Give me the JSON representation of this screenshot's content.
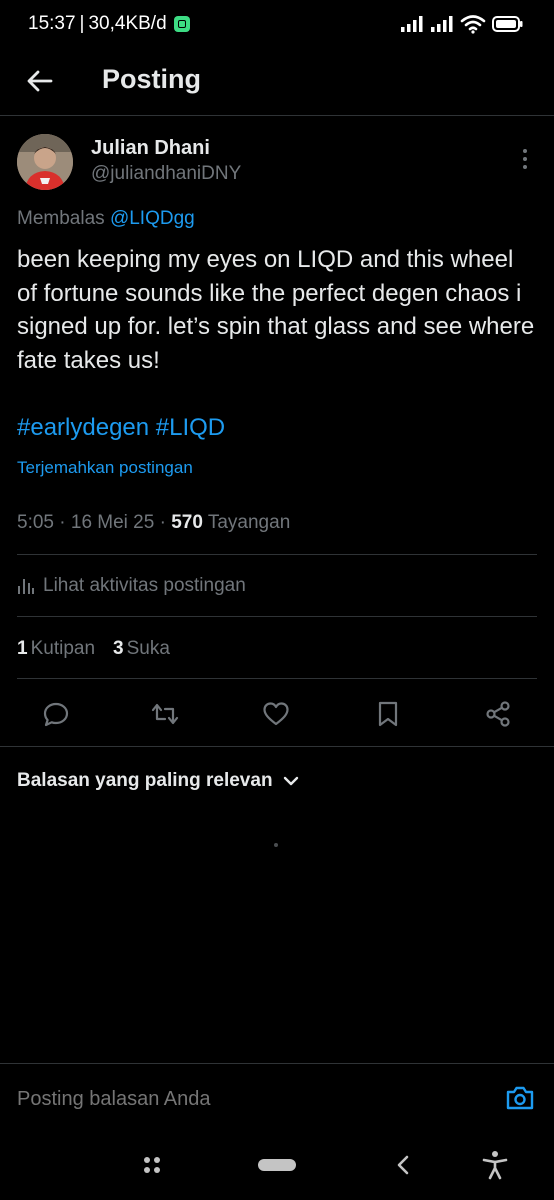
{
  "status_bar": {
    "time": "15:37",
    "net_speed": "30,4KB/d"
  },
  "header": {
    "title": "Posting"
  },
  "post": {
    "author_name": "Julian Dhani",
    "author_handle": "@juliandhaniDNY",
    "replying_prefix": "Membalas",
    "replying_to": "@LIQDgg",
    "text": "been keeping my eyes on LIQD and this wheel of fortune sounds like the perfect degen chaos i signed up for. let’s spin that glass and see where fate takes us!",
    "hashtags": "#earlydegen #LIQD",
    "translate_label": "Terjemahkan postingan",
    "time": "5:05",
    "date": "16 Mei 25",
    "views_count": "570",
    "views_label": "Tayangan",
    "activity_label": "Lihat aktivitas postingan",
    "quotes_count": "1",
    "quotes_label": "Kutipan",
    "likes_count": "3",
    "likes_label": "Suka"
  },
  "replies": {
    "sort_label": "Balasan yang paling relevan"
  },
  "reply_box": {
    "placeholder": "Posting balasan Anda"
  },
  "colors": {
    "background": "#000000",
    "text": "#e7e9ea",
    "muted": "#71767b",
    "accent": "#1d9bf0",
    "divider": "#2f3336"
  },
  "icons": {
    "back": "arrow-left-icon",
    "more": "more-vertical-icon",
    "activity": "bar-chart-icon",
    "reply": "reply-icon",
    "repost": "repost-icon",
    "like": "heart-icon",
    "bookmark": "bookmark-icon",
    "share": "share-icon",
    "sort": "chevron-down-icon",
    "camera": "camera-icon"
  }
}
